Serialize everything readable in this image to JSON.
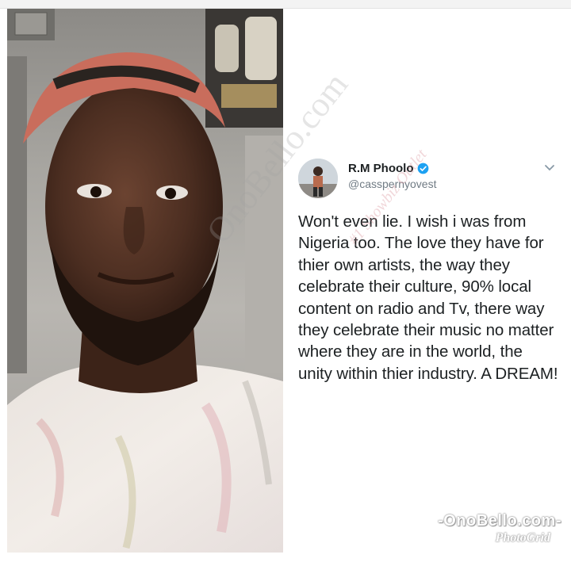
{
  "tweet": {
    "display_name": "R.M Phoolo",
    "handle": "@casspernyovest",
    "verified": true,
    "text": "Won't even lie. I wish i was from Nigeria too. The love they have for thier own artists, the way they celebrate their culture, 90% local content on radio and Tv,  there way they celebrate their music no matter where they are in the world, the unity within thier industry. A DREAM!",
    "icons": {
      "verified": "verified-badge-icon",
      "menu": "chevron-down-icon"
    },
    "colors": {
      "verified": "#1da1f2",
      "text": "#1c2022",
      "handle": "#707b84"
    }
  },
  "watermarks": {
    "diagonal": "OnoBello.com",
    "script": "#1 Showbiz Outlet",
    "bottom": "-OnoBello.com-",
    "bottom_sub": "PhotoGrid"
  }
}
